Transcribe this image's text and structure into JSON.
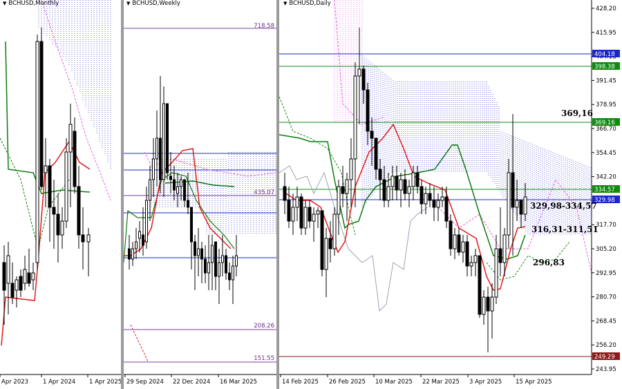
{
  "chart_data": [
    {
      "type": "candlestick",
      "symbol_label": "BCHUSD,Monthly",
      "x_tick_labels": [
        "Apr 2023",
        "1 Apr 2024",
        "1 Apr 2025"
      ],
      "level_labels": []
    },
    {
      "type": "candlestick",
      "symbol_label": "BCHUSD,Weekly",
      "x_tick_labels": [
        "29 Sep 2024",
        "22 Dec 2024",
        "16 Mar 2025"
      ],
      "level_labels": [
        "718.58",
        "435.07",
        "208.26",
        "151.55"
      ]
    },
    {
      "type": "candlestick",
      "symbol_label": "BCHUSD,Daily",
      "x_tick_labels": [
        "14 Feb 2025",
        "26 Feb 2025",
        "10 Mar 2025",
        "22 Mar 2025",
        "3 Apr 2025",
        "15 Apr 2025"
      ],
      "y_tick_labels": [
        "428.20",
        "415.95",
        "404.18",
        "391.45",
        "378.95",
        "366.70",
        "354.45",
        "342.20",
        "329.98",
        "317.70",
        "305.20",
        "292.95",
        "280.70",
        "268.45",
        "256.20",
        "243.95"
      ],
      "price_boxes": [
        {
          "value": "404.18",
          "color": "#1a27c9"
        },
        {
          "value": "398.38",
          "color": "#0f8a0f"
        },
        {
          "value": "369.16",
          "color": "#0f8a0f"
        },
        {
          "value": "334.57",
          "color": "#0f8a0f"
        },
        {
          "value": "329.98",
          "color": "#1a27c9"
        },
        {
          "value": "249.29",
          "color": "#8b1a1a"
        }
      ],
      "annotations": [
        "369,16",
        "329,98-334,57",
        "316,31-311,51",
        "296,83"
      ]
    }
  ]
}
